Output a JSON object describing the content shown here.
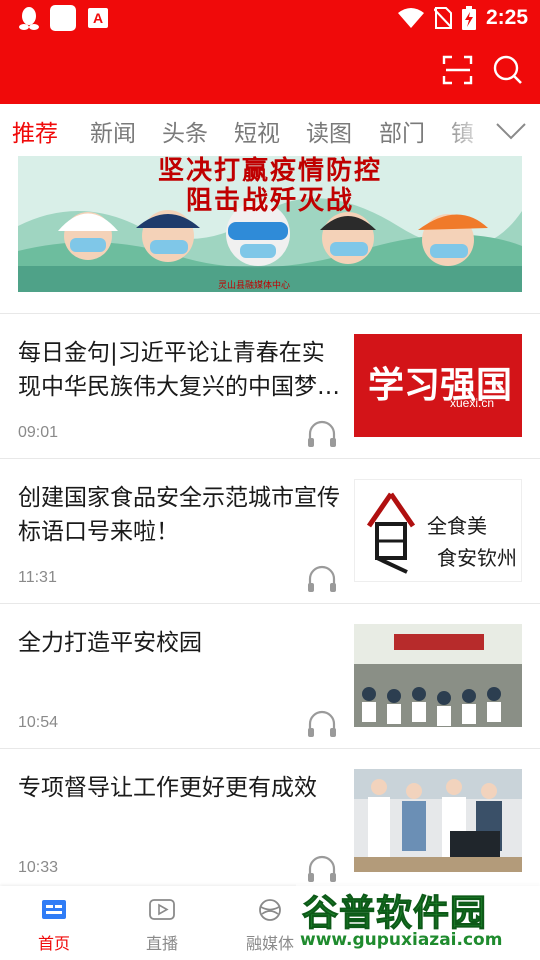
{
  "status_bar": {
    "time": "2:25",
    "app_icon_letter": "A",
    "icons": [
      "qq-icon",
      "notification-box-icon",
      "app-icon",
      "wifi-icon",
      "no-sim-icon",
      "battery-charging-icon"
    ]
  },
  "header": {
    "background": "#f00a0a",
    "actions": [
      "scan-icon",
      "search-icon"
    ]
  },
  "tabs": {
    "items": [
      "推荐",
      "新闻",
      "头条",
      "短视",
      "读图",
      "部门",
      "镇"
    ],
    "active_index": 0,
    "more_icon": "chevron-down-icon"
  },
  "banner": {
    "line1": "坚决打赢疫情防控",
    "line2": "阻击战歼灭战",
    "caption": "灵山县融媒体中心"
  },
  "news": [
    {
      "title": "每日金句|习近平论让青春在实现中华民族伟大复兴的中国梦中绽放光彩",
      "time": "09:01",
      "thumb_text": "学习强国",
      "thumb_sub": "xuexi.cn"
    },
    {
      "title": "创建国家食品安全示范城市宣传标语口号来啦！",
      "time": "11:31",
      "thumb_text": "全食美",
      "thumb_sub": "食安钦州"
    },
    {
      "title": "全力打造平安校园",
      "time": "10:54"
    },
    {
      "title": "专项督导让工作更好更有成效",
      "time": "10:33"
    }
  ],
  "bottom_nav": {
    "items": [
      {
        "label": "首页",
        "icon": "home-icon"
      },
      {
        "label": "直播",
        "icon": "play-icon"
      },
      {
        "label": "融媒体",
        "icon": "globe-icon"
      }
    ],
    "active_index": 0
  },
  "watermark": {
    "text": "谷普软件园",
    "url": "www.gupuxiazai.com"
  }
}
